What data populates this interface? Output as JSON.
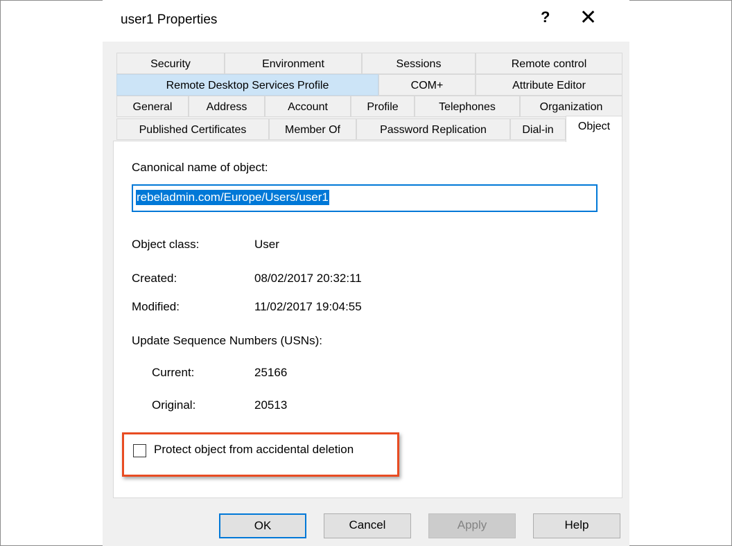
{
  "window": {
    "title": "user1 Properties",
    "help_glyph": "?",
    "close_glyph": "✕"
  },
  "tabs": {
    "row1": [
      {
        "label": "Security"
      },
      {
        "label": "Environment"
      },
      {
        "label": "Sessions"
      },
      {
        "label": "Remote control"
      }
    ],
    "row2": [
      {
        "label": "Remote Desktop Services Profile"
      },
      {
        "label": "COM+"
      },
      {
        "label": "Attribute Editor"
      }
    ],
    "row3": [
      {
        "label": "General"
      },
      {
        "label": "Address"
      },
      {
        "label": "Account"
      },
      {
        "label": "Profile"
      },
      {
        "label": "Telephones"
      },
      {
        "label": "Organization"
      }
    ],
    "row4": [
      {
        "label": "Published Certificates"
      },
      {
        "label": "Member Of"
      },
      {
        "label": "Password Replication"
      },
      {
        "label": "Dial-in"
      },
      {
        "label": "Object"
      }
    ],
    "active": "Object",
    "highlighted": "Remote Desktop Services Profile"
  },
  "object": {
    "canonical_label": "Canonical name of object:",
    "canonical_value": "rebeladmin.com/Europe/Users/user1",
    "class_label": "Object class:",
    "class_value": "User",
    "created_label": "Created:",
    "created_value": "08/02/2017 20:32:11",
    "modified_label": "Modified:",
    "modified_value": "11/02/2017 19:04:55",
    "usn_label": "Update Sequence Numbers (USNs):",
    "current_label": "Current:",
    "current_value": "25166",
    "original_label": "Original:",
    "original_value": "20513",
    "protect_label": "Protect object from accidental deletion",
    "protect_checked": false
  },
  "buttons": {
    "ok": "OK",
    "cancel": "Cancel",
    "apply": "Apply",
    "help": "Help"
  },
  "colors": {
    "accent": "#0078d7",
    "highlight_box": "#e84c22",
    "tab_highlight": "#cce4f7"
  }
}
